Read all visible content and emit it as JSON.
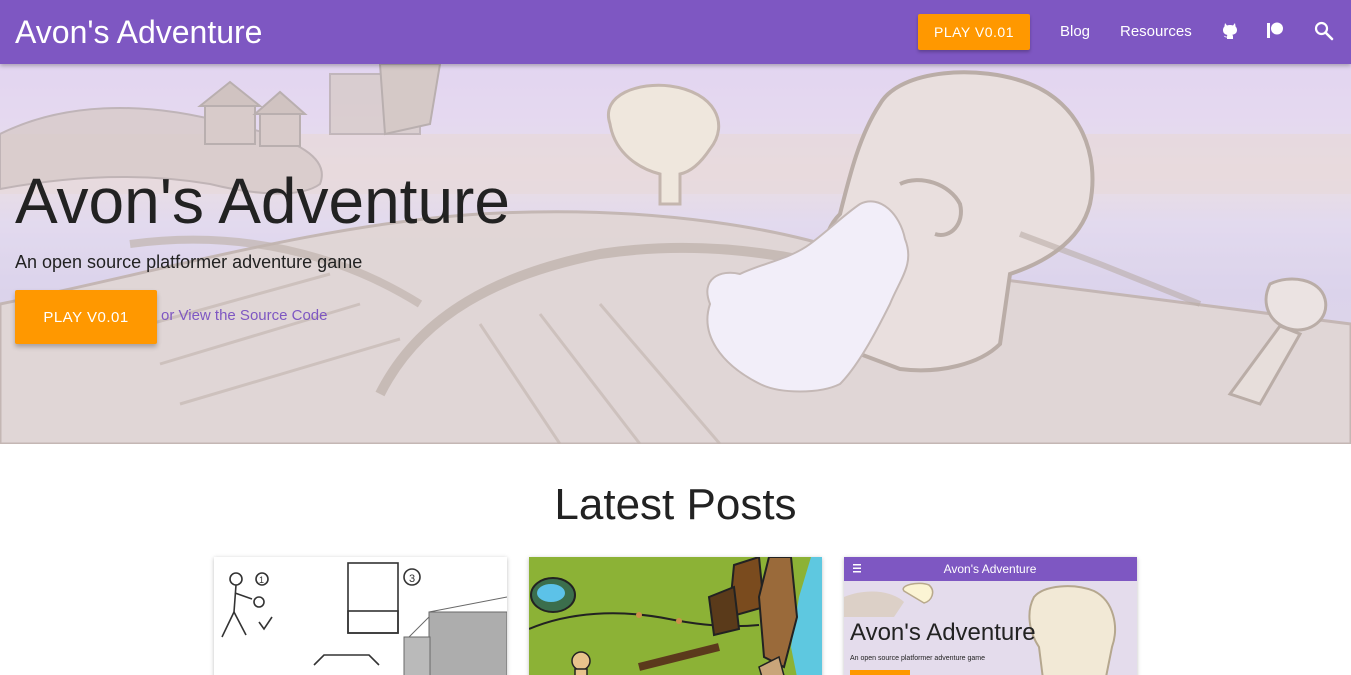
{
  "nav": {
    "brand": "Avon's Adventure",
    "play_label": "PLAY V0.01",
    "links": [
      {
        "label": "Blog"
      },
      {
        "label": "Resources"
      }
    ],
    "icons": [
      "github-icon",
      "patreon-icon",
      "search-icon"
    ]
  },
  "hero": {
    "title": "Avon's Adventure",
    "subtitle": "An open source platformer adventure game",
    "play_label": "PLAY V0.01",
    "source_link": "or View the Source Code"
  },
  "posts": {
    "heading": "Latest Posts",
    "cards": [
      {
        "thumb": "storyboard-sketch"
      },
      {
        "thumb": "green-level-drawing"
      },
      {
        "thumb": "site-screenshot",
        "screenshot_nav_title": "Avon's Adventure",
        "screenshot_title": "Avon's Adventure",
        "screenshot_subtitle": "An open source platformer adventure game"
      }
    ]
  },
  "colors": {
    "primary": "#7e57c2",
    "accent": "#ff9800"
  }
}
